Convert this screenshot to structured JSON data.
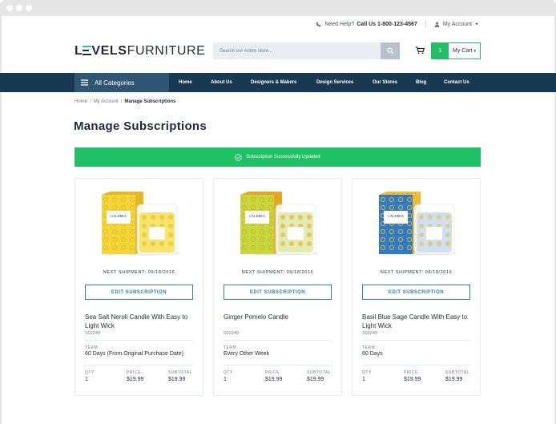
{
  "header": {
    "need_help": "Need Help?",
    "help_phone": "Call Us 1-800-123-4567",
    "account_label": "My Account",
    "logo_bold": "LEVELS",
    "logo_rest": "FURNITURE",
    "search_placeholder": "Search our entire store...",
    "cart_count": "1",
    "cart_label": "My Cart"
  },
  "nav": {
    "categories_label": "All Categories",
    "links": [
      "Home",
      "About Us",
      "Designers & Makers",
      "Design Services",
      "Our Stores",
      "Blog",
      "Contact Us"
    ]
  },
  "breadcrumb": {
    "items": [
      "Home",
      "My Account"
    ],
    "current": "Manage Subscriptions"
  },
  "page": {
    "title": "Manage Subscriptions",
    "success_message": "Subscription Successfully Updated"
  },
  "labels": {
    "edit_subscription": "EDIT SUBSCRIPTION",
    "term": "TERM",
    "qty": "QTY",
    "price": "PRICE",
    "subtotal": "SUBTOTAL"
  },
  "products": [
    {
      "next_shipment": "NEXT SHIPMENT: 09/18/2016",
      "name": "Sea Salt Neroli Candle With Easy to Light Wick",
      "sku": "S02249",
      "term": "60 Days (From Original Purchase Date)",
      "qty": "1",
      "price": "$19.99",
      "subtotal": "$19.99",
      "colors": {
        "box": "#f3d53a",
        "accent": "#e6b820",
        "glass": "#f7e46a"
      }
    },
    {
      "next_shipment": "NEXT SHIPMENT: 09/18/2016",
      "name": "Ginger Pomelo Candle",
      "sku": "S02249",
      "term": "Every Other Week",
      "qty": "1",
      "price": "$19.99",
      "subtotal": "$19.99",
      "colors": {
        "box": "#c3da3f",
        "accent": "#e7a321",
        "glass": "#e2ecb0"
      }
    },
    {
      "next_shipment": "NEXT SHIPMENT: 09/18/2016",
      "name": "Basil Blue Sage Candle With Easy to Light Wick",
      "sku": "S02249",
      "term": "60 Days",
      "qty": "1",
      "price": "$19.99",
      "subtotal": "$19.99",
      "colors": {
        "box": "#2f7cc4",
        "accent": "#f1b934",
        "glass": "#cfe0f2"
      }
    }
  ],
  "product_brand": "CALDREA",
  "colors": {
    "navy": "#173a52",
    "success_green": "#1fc066",
    "link_blue": "#2b7fb5"
  }
}
